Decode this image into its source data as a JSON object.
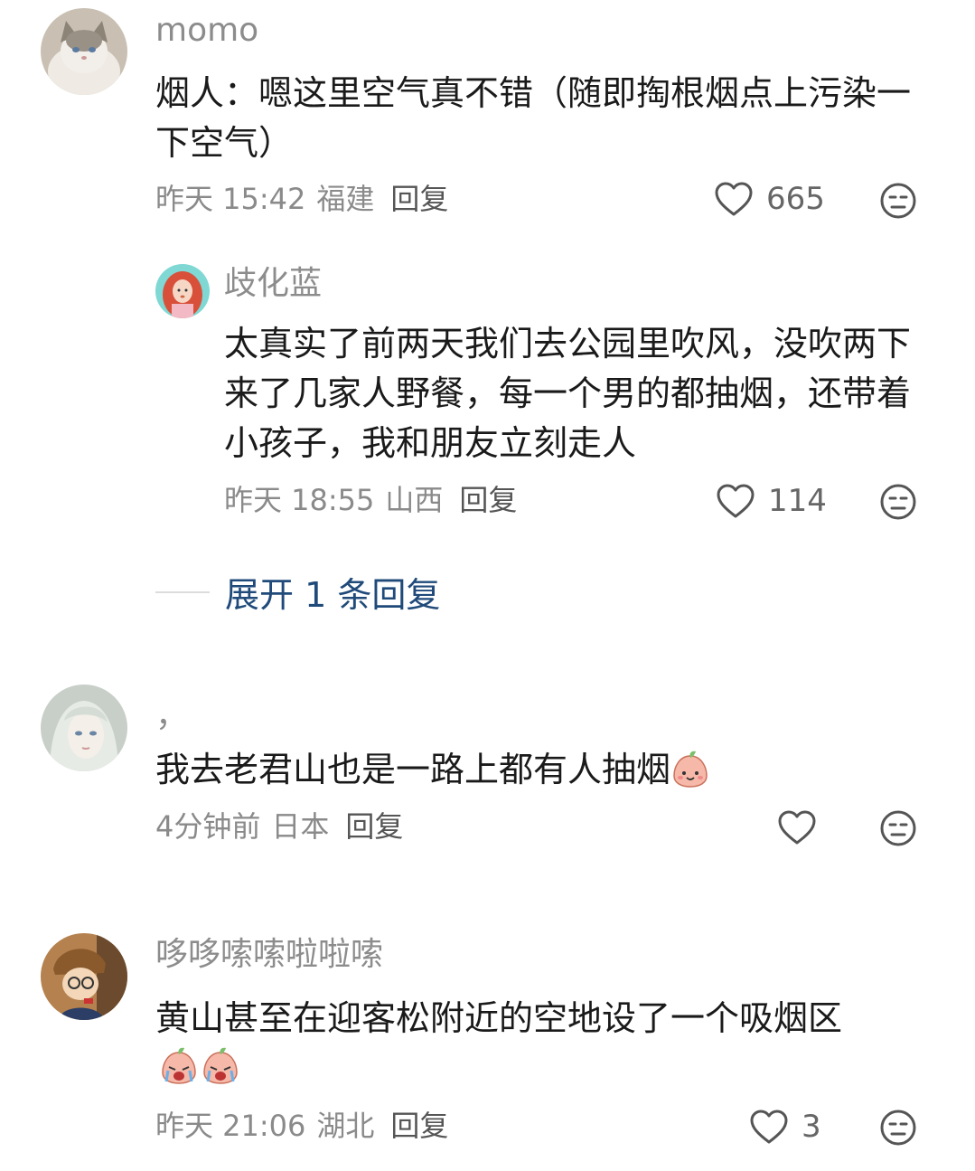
{
  "comments": [
    {
      "username": "momo",
      "text": "烟人：嗯这里空气真不错（随即掏根烟点上污染一下空气）",
      "time": "昨天 15:42",
      "location": "福建",
      "reply_label": "回复",
      "likes": "665",
      "replies": [
        {
          "username": "歧化蓝",
          "text": "太真实了前两天我们去公园里吹风，没吹两下来了几家人野餐，每一个男的都抽烟，还带着小孩子，我和朋友立刻走人",
          "time": "昨天 18:55",
          "location": "山西",
          "reply_label": "回复",
          "likes": "114"
        }
      ],
      "expand_label": "展开 1 条回复"
    },
    {
      "username": "，",
      "text": "我去老君山也是一路上都有人抽烟",
      "time": "4分钟前",
      "location": "日本",
      "reply_label": "回复",
      "likes": ""
    },
    {
      "username": "哆哆嗦嗦啦啦嗦",
      "text": "黄山甚至在迎客松附近的空地设了一个吸烟区",
      "time": "昨天 21:06",
      "location": "湖北",
      "reply_label": "回复",
      "likes": "3"
    }
  ],
  "icons": {
    "like": "heart-outline-icon",
    "dislike": "unamused-face-icon",
    "emoji_smile": "peach-smile-emoji",
    "emoji_cry": "peach-cry-emoji"
  },
  "colors": {
    "link_blue": "#1f4a7a",
    "meta_gray": "#8a8a8a"
  }
}
